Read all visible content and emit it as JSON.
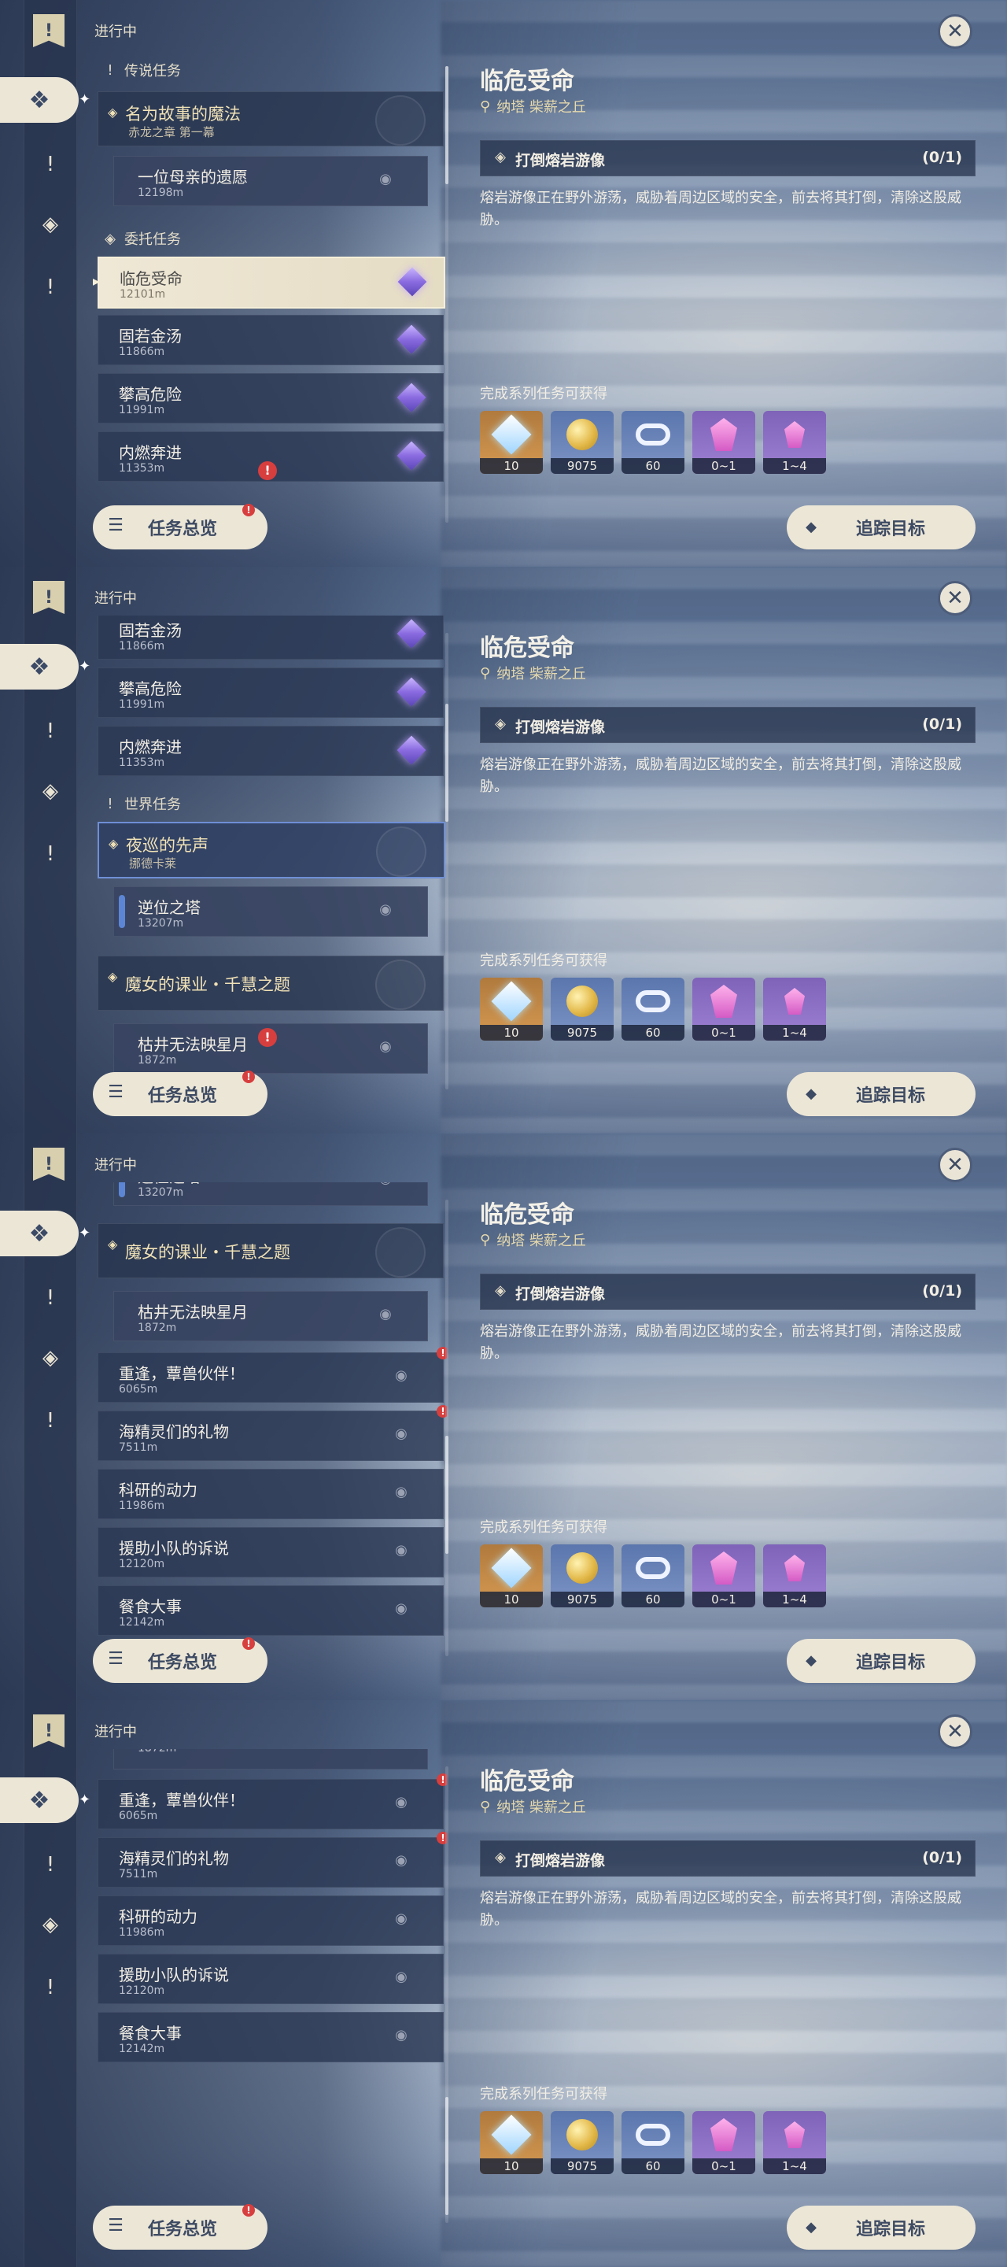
{
  "header": {
    "status_label": "进行中"
  },
  "detail": {
    "title": "临危受命",
    "location": "纳塔 柴薪之丘",
    "objective": {
      "text": "打倒熔岩游像",
      "progress": "(0/1)"
    },
    "description": "熔岩游像正在野外游荡，威胁着周边区域的安全，前去将其打倒，清除这股威胁。",
    "rewards_label": "完成系列任务可获得",
    "rewards": [
      {
        "icon": "primogem-icon",
        "count": "10"
      },
      {
        "icon": "mora-icon",
        "count": "9075"
      },
      {
        "icon": "companionship-exp-icon",
        "count": "60"
      },
      {
        "icon": "crystal-icon",
        "count": "0~1"
      },
      {
        "icon": "crystal-chunk-icon",
        "count": "1~4"
      }
    ]
  },
  "buttons": {
    "overview": "任务总览",
    "track": "追踪目标"
  },
  "sections": {
    "legend": "传说任务",
    "commission": "委托任务",
    "world": "世界任务"
  },
  "chapters": {
    "legend": {
      "title": "名为故事的魔法",
      "subtitle": "赤龙之章 第一幕"
    },
    "world": {
      "title": "夜巡的先声",
      "subtitle": "挪德卡莱"
    },
    "witch": {
      "title": "魔女的课业・千慧之题"
    }
  },
  "quests": {
    "q_mother": {
      "title": "一位母亲的遗愿",
      "distance": "12198m"
    },
    "q_linwei": {
      "title": "临危受命",
      "distance": "12101m"
    },
    "q_guruo": {
      "title": "固若金汤",
      "distance": "11866m"
    },
    "q_pangao": {
      "title": "攀高危险",
      "distance": "11991m"
    },
    "q_neiran": {
      "title": "内燃奔进",
      "distance": "11353m"
    },
    "q_niwei": {
      "title": "逆位之塔",
      "distance": "13207m"
    },
    "q_kujing": {
      "title": "枯井无法映星月",
      "distance": "1872m"
    },
    "q_chongfeng": {
      "title": "重逢，蕈兽伙伴！",
      "distance": "6065m"
    },
    "q_haijing": {
      "title": "海精灵们的礼物",
      "distance": "7511m"
    },
    "q_keyan": {
      "title": "科研的动力",
      "distance": "11986m"
    },
    "q_yuanzhu": {
      "title": "援助小队的诉说",
      "distance": "12120m"
    },
    "q_canshi": {
      "title": "餐食大事",
      "distance": "12142m"
    }
  },
  "colors": {
    "accent": "#ece6d6",
    "gold_text": "#f1e2b6",
    "alert": "#d73e3e",
    "world_border": "#6f8fd6"
  }
}
